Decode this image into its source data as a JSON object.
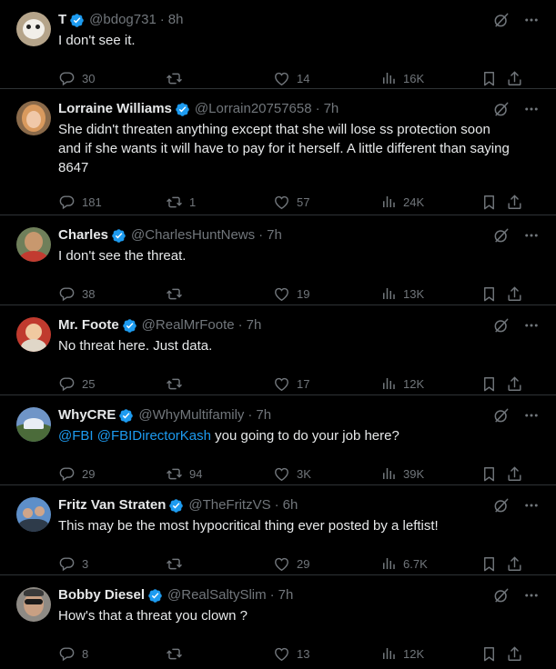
{
  "tweets": [
    {
      "name": "T",
      "handle": "@bdog731",
      "time": "8h",
      "text": "I don't see it.",
      "replies": "30",
      "reposts": "",
      "likes": "14",
      "views": "16K",
      "avatar_colors": {
        "bg": "#b5a48a",
        "fg": "#f2efe9"
      }
    },
    {
      "name": "Lorraine Williams",
      "handle": "@Lorrain20757658",
      "time": "7h",
      "text": "She didn't threaten anything except that she will lose ss protection soon and if she wants it will have to pay for it herself. A little different than saying 8647",
      "replies": "181",
      "reposts": "1",
      "likes": "57",
      "views": "24K",
      "avatar_colors": {
        "bg": "#8a6a4a",
        "fg": "#d6a36a"
      }
    },
    {
      "name": "Charles",
      "handle": "@CharlesHuntNews",
      "time": "7h",
      "text": "I don't see the threat.",
      "replies": "38",
      "reposts": "",
      "likes": "19",
      "views": "13K",
      "avatar_colors": {
        "bg": "#6f7f5a",
        "fg": "#c8986e"
      }
    },
    {
      "name": "Mr. Foote",
      "handle": "@RealMrFoote",
      "time": "7h",
      "text": "No threat here. Just data.",
      "replies": "25",
      "reposts": "",
      "likes": "17",
      "views": "12K",
      "avatar_colors": {
        "bg": "#c03a2e",
        "fg": "#f0c9a0"
      }
    },
    {
      "name": "WhyCRE",
      "handle": "@WhyMultifamily",
      "time": "7h",
      "mention1": "@FBI",
      "mention2": "@FBIDirectorKash",
      "text": " you going to do your job here?",
      "replies": "29",
      "reposts": "94",
      "likes": "3K",
      "views": "39K",
      "avatar_colors": {
        "bg": "#6f95c7",
        "fg": "#4b6b3a"
      }
    },
    {
      "name": "Fritz Van Straten",
      "handle": "@TheFritzVS",
      "time": "6h",
      "text": "This may be the most hypocritical thing ever posted by a leftist!",
      "replies": "3",
      "reposts": "",
      "likes": "29",
      "views": "6.7K",
      "avatar_colors": {
        "bg": "#5e8fc9",
        "fg": "#cfa58a"
      }
    },
    {
      "name": "Bobby Diesel",
      "handle": "@RealSaltySlim",
      "time": "7h",
      "text": "How's that a threat you clown ?",
      "replies": "8",
      "reposts": "",
      "likes": "13",
      "views": "12K",
      "avatar_colors": {
        "bg": "#8e8a84",
        "fg": "#c9a083"
      }
    }
  ],
  "colors": {
    "accent": "#1d9bf0",
    "muted": "#71767b",
    "border": "#2f3336",
    "background": "#000000"
  }
}
